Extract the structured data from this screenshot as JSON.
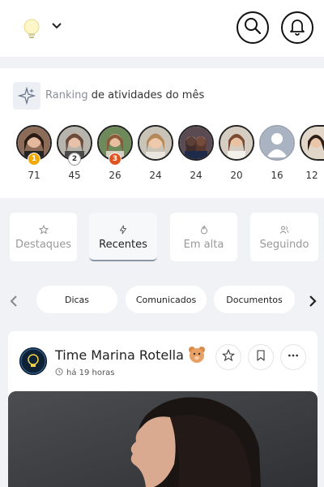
{
  "header": {
    "logo_icon": "lightbulb-icon",
    "dropdown_icon": "chevron-down-icon",
    "search_icon": "search-icon",
    "notification_icon": "bell-icon"
  },
  "ranking": {
    "icon": "sparkles-icon",
    "title_highlight": "Ranking",
    "title_rest": " de atividades do mês",
    "users": [
      {
        "score": "71",
        "badge": "1",
        "badge_color": "#f2a900"
      },
      {
        "score": "45",
        "badge": "2",
        "badge_color": "#ffffff"
      },
      {
        "score": "26",
        "badge": "3",
        "badge_color": "#e0531f"
      },
      {
        "score": "24"
      },
      {
        "score": "24"
      },
      {
        "score": "20"
      },
      {
        "score": "16"
      },
      {
        "score": "12"
      }
    ]
  },
  "tabs": [
    {
      "label": "Destaques",
      "icon": "star-icon"
    },
    {
      "label": "Recentes",
      "icon": "lightning-icon",
      "active": true
    },
    {
      "label": "Em alta",
      "icon": "fire-icon"
    },
    {
      "label": "Seguindo",
      "icon": "users-icon"
    }
  ],
  "categories": [
    "Dicas",
    "Comunicados",
    "Documentos"
  ],
  "post": {
    "author": "Time Marina Rotella",
    "time": "há 19 horas",
    "actions": [
      "star-icon",
      "bookmark-icon",
      "more-icon"
    ]
  },
  "colors": {
    "background": "#f1f2f5",
    "card": "#ffffff",
    "muted_text": "#999999",
    "active_tab_border": "#8e95a6"
  }
}
